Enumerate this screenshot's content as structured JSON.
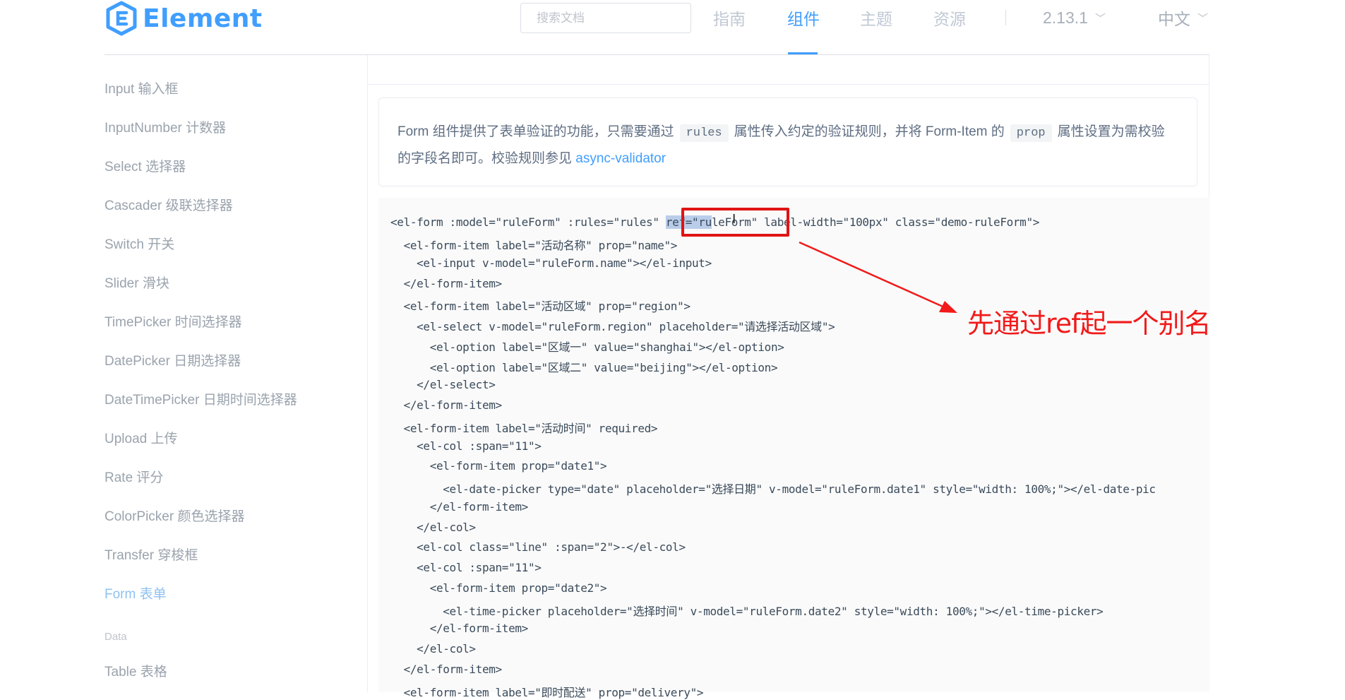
{
  "brand": {
    "logo_text": "Element",
    "logo_color": "#409eff"
  },
  "header": {
    "search_placeholder": "搜索文档",
    "nav": [
      {
        "label": "指南",
        "active": false
      },
      {
        "label": "组件",
        "active": true
      },
      {
        "label": "主题",
        "active": false
      },
      {
        "label": "资源",
        "active": false
      }
    ],
    "version": "2.13.1",
    "language": "中文"
  },
  "sidebar": {
    "items": [
      "Input 输入框",
      "InputNumber 计数器",
      "Select 选择器",
      "Cascader 级联选择器",
      "Switch 开关",
      "Slider 滑块",
      "TimePicker 时间选择器",
      "DatePicker 日期选择器",
      "DateTimePicker 日期时间选择器",
      "Upload 上传",
      "Rate 评分",
      "ColorPicker 颜色选择器",
      "Transfer 穿梭框",
      "Form 表单"
    ],
    "active_item": "Form 表单",
    "group_label": "Data",
    "group_items": [
      "Table 表格"
    ]
  },
  "tip": {
    "text_1": "Form 组件提供了表单验证的功能，只需要通过",
    "code_1": "rules",
    "text_2": "属性传入约定的验证规则，并将 Form-Item 的",
    "code_2": "prop",
    "text_3": "属性设置为需校验",
    "text_4": "的字段名即可。校验规则参见",
    "link": "async-validator"
  },
  "code": {
    "line_1_before": "<el-form :model=\"ruleForm\" :rules=\"rules\" ",
    "line_1_highlight": "ref=\"ru",
    "line_1_after": "leForm\" label-width=\"100px\" class=\"demo-ruleForm\">",
    "lines": [
      "  <el-form-item label=\"活动名称\" prop=\"name\">",
      "    <el-input v-model=\"ruleForm.name\"></el-input>",
      "  </el-form-item>",
      "  <el-form-item label=\"活动区域\" prop=\"region\">",
      "    <el-select v-model=\"ruleForm.region\" placeholder=\"请选择活动区域\">",
      "      <el-option label=\"区域一\" value=\"shanghai\"></el-option>",
      "      <el-option label=\"区域二\" value=\"beijing\"></el-option>",
      "    </el-select>",
      "  </el-form-item>",
      "  <el-form-item label=\"活动时间\" required>",
      "    <el-col :span=\"11\">",
      "      <el-form-item prop=\"date1\">",
      "        <el-date-picker type=\"date\" placeholder=\"选择日期\" v-model=\"ruleForm.date1\" style=\"width: 100%;\"></el-date-pic",
      "      </el-form-item>",
      "    </el-col>",
      "    <el-col class=\"line\" :span=\"2\">-</el-col>",
      "    <el-col :span=\"11\">",
      "      <el-form-item prop=\"date2\">",
      "        <el-time-picker placeholder=\"选择时间\" v-model=\"ruleForm.date2\" style=\"width: 100%;\"></el-time-picker>",
      "      </el-form-item>",
      "    </el-col>",
      "  </el-form-item>",
      "  <el-form-item label=\"即时配送\" prop=\"delivery\">"
    ]
  },
  "annotation": {
    "text": "先通过ref起一个别名",
    "color": "#f21a1a"
  }
}
